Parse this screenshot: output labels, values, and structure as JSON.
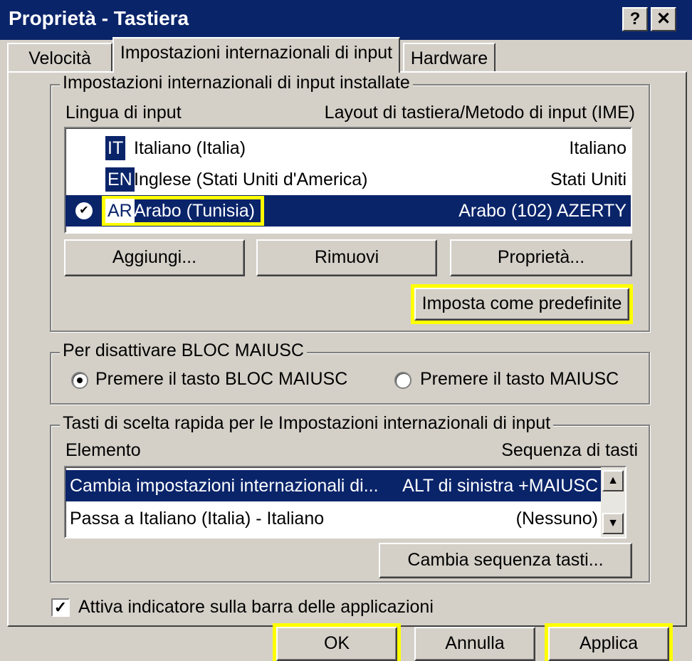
{
  "window": {
    "title": "Proprietà - Tastiera",
    "help_glyph": "?",
    "close_glyph": "✕"
  },
  "tabs": [
    {
      "label": "Velocità"
    },
    {
      "label": "Impostazioni internazionali di input"
    },
    {
      "label": "Hardware"
    }
  ],
  "installed": {
    "legend": "Impostazioni internazionali di input installate",
    "col_language": "Lingua di input",
    "col_layout": "Layout di tastiera/Metodo di input (IME)",
    "items": [
      {
        "code": "IT",
        "language": "Italiano (Italia)",
        "layout": "Italiano",
        "selected": false
      },
      {
        "code": "EN",
        "language": "Inglese (Stati Uniti d'America)",
        "layout": "Stati Uniti",
        "selected": false
      },
      {
        "code": "AR",
        "language": "Arabo (Tunisia)",
        "layout": "Arabo (102) AZERTY",
        "selected": true,
        "check": "✔"
      }
    ],
    "buttons": {
      "add": "Aggiungi...",
      "remove": "Rimuovi",
      "properties": "Proprietà...",
      "set_default": "Imposta come predefinite"
    }
  },
  "capslock": {
    "legend": "Per disattivare BLOC MAIUSC",
    "option_capslock": "Premere il tasto BLOC MAIUSC",
    "option_shift": "Premere il tasto MAIUSC",
    "selected": "capslock"
  },
  "hotkeys": {
    "legend": "Tasti di scelta rapida per le Impostazioni internazionali di input",
    "col_item": "Elemento",
    "col_sequence": "Sequenza di tasti",
    "items": [
      {
        "item": "Cambia impostazioni internazionali di...",
        "sequence": "ALT di sinistra +MAIUSC",
        "selected": true
      },
      {
        "item": "Passa a Italiano (Italia) - Italiano",
        "sequence": "(Nessuno)",
        "selected": false
      }
    ],
    "change_button": "Cambia sequenza tasti...",
    "scroll_up": "▲",
    "scroll_down": "▼"
  },
  "taskbar_indicator": {
    "label": "Attiva indicatore sulla barra delle applicazioni",
    "checked": true,
    "check_glyph": "✓"
  },
  "footer": {
    "ok": "OK",
    "cancel": "Annulla",
    "apply": "Applica"
  },
  "colors": {
    "highlight": "#ffff00",
    "selection": "#0a246a",
    "face": "#d4d0c8"
  }
}
